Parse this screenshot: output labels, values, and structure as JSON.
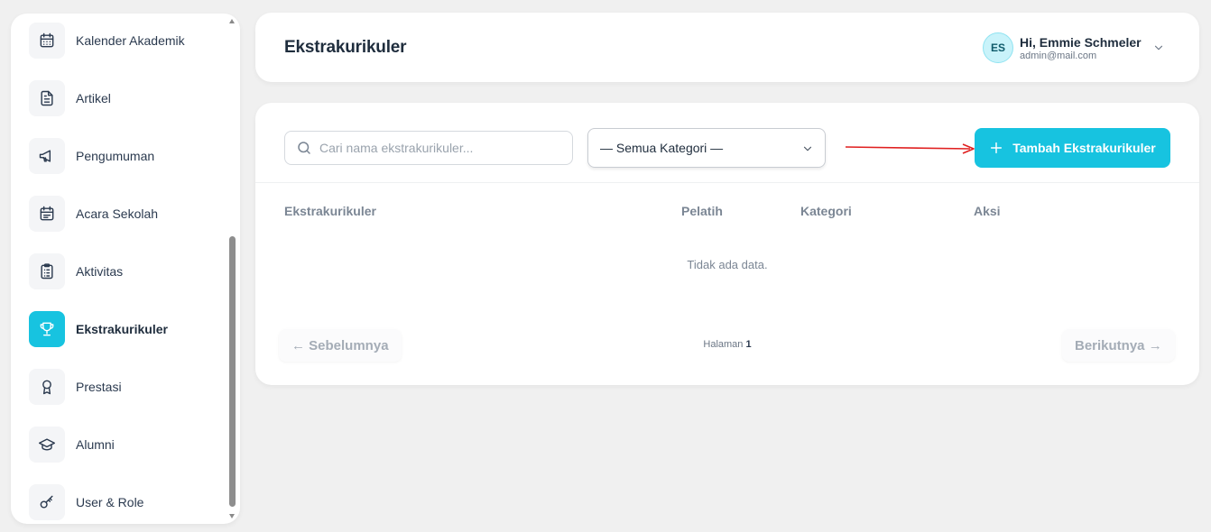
{
  "sidebar": {
    "items": [
      {
        "label": "Kalender Akademik",
        "icon": "calendar-icon"
      },
      {
        "label": "Artikel",
        "icon": "document-icon"
      },
      {
        "label": "Pengumuman",
        "icon": "megaphone-icon"
      },
      {
        "label": "Acara Sekolah",
        "icon": "calendar-event-icon"
      },
      {
        "label": "Aktivitas",
        "icon": "clipboard-icon"
      },
      {
        "label": "Ekstrakurikuler",
        "icon": "trophy-icon",
        "active": true
      },
      {
        "label": "Prestasi",
        "icon": "award-icon"
      },
      {
        "label": "Alumni",
        "icon": "graduation-cap-icon"
      },
      {
        "label": "User & Role",
        "icon": "key-icon"
      }
    ]
  },
  "header": {
    "title": "Ekstrakurikuler",
    "user": {
      "initials": "ES",
      "greeting": "Hi, Emmie Schmeler",
      "email": "admin@mail.com"
    }
  },
  "filters": {
    "search_placeholder": "Cari nama ekstrakurikuler...",
    "category_selected": "— Semua Kategori —"
  },
  "actions": {
    "add_label": "Tambah Ekstrakurikuler"
  },
  "table": {
    "columns": [
      "Ekstrakurikuler",
      "Pelatih",
      "Kategori",
      "Aksi"
    ],
    "empty_text": "Tidak ada data."
  },
  "pagination": {
    "prev_label": "← Sebelumnya",
    "next_label": "Berikutnya →",
    "page_label": "Halaman",
    "page_number": "1"
  },
  "colors": {
    "accent": "#17c3e0",
    "annotation_arrow": "#e02020"
  }
}
